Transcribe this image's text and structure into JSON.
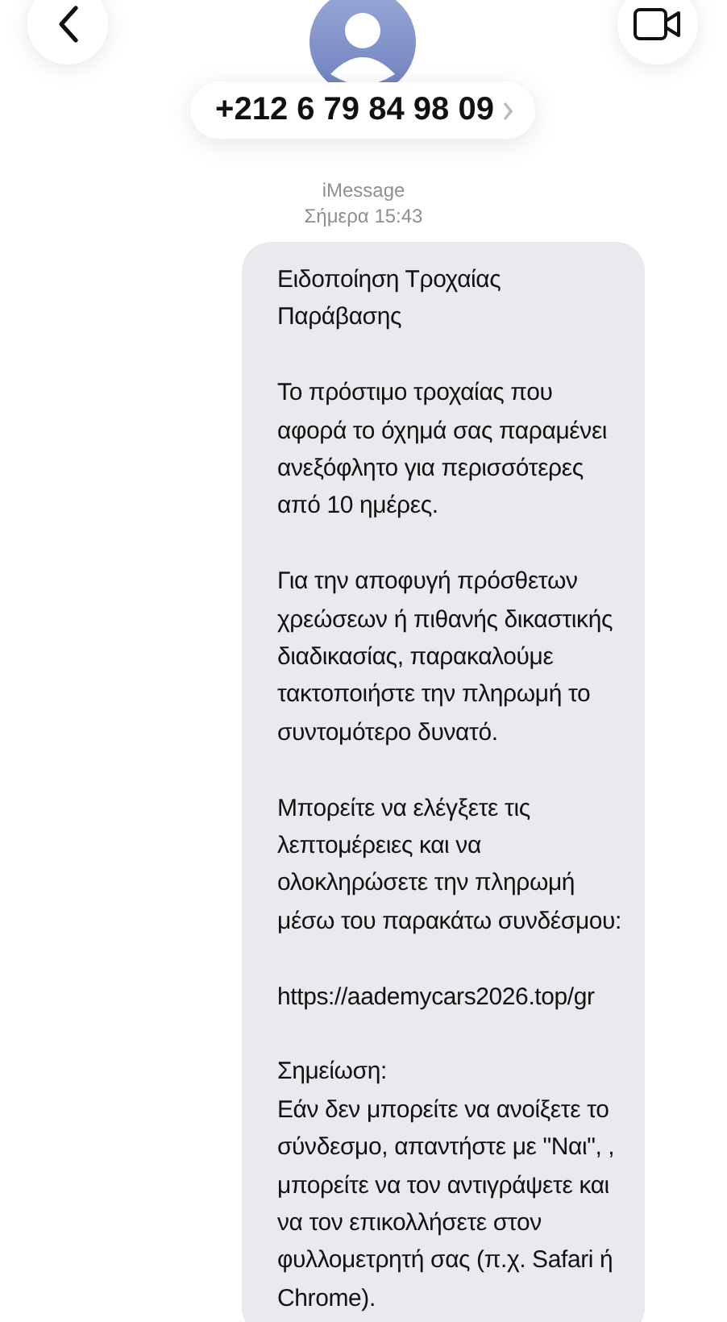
{
  "contact": {
    "phone": "+212 6 79 84 98 09"
  },
  "service": "iMessage",
  "timestamp": "Σήμερα 15:43",
  "message": {
    "paragraphs": [
      [
        "Ειδοποίηση Τροχαίας",
        "Παράβασης"
      ],
      [
        "Το πρόστιμο τροχαίας που",
        "αφορά το όχημά σας παραμένει",
        "ανεξόφλητο για περισσότερες",
        "από 10 ημέρες."
      ],
      [
        "Για την αποφυγή πρόσθετων",
        "χρεώσεων ή πιθανής δικαστικής",
        "διαδικασίας, παρακαλούμε",
        "τακτοποιήστε την πληρωμή το",
        "συντομότερο δυνατό."
      ],
      [
        "Μπορείτε να ελέγξετε τις",
        "λεπτομέρειες και να",
        "ολοκληρώσετε την πληρωμή",
        "μέσω του παρακάτω συνδέσμου:"
      ],
      [
        "https://aademycars2026.top/gr"
      ],
      [
        "Σημείωση:",
        "Εάν δεν μπορείτε να ανοίξετε το",
        "σύνδεσμο, απαντήστε με \"Ναι\", ,",
        "μπορείτε να τον αντιγράψετε και",
        "να τον επικολλήσετε στον",
        "φυλλομετρητή σας (π.χ. Safari ή",
        "Chrome)."
      ]
    ]
  }
}
